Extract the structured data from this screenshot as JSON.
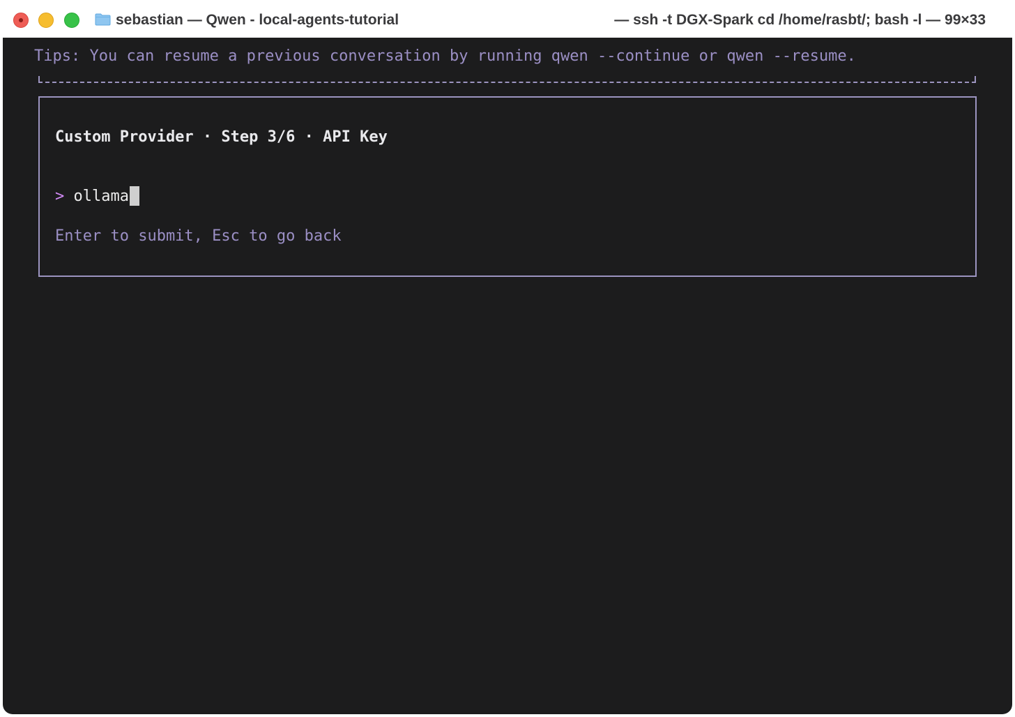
{
  "window": {
    "title_left": "sebastian — Qwen - local-agents-tutorial",
    "title_right": "— ssh -t DGX-Spark cd /home/rasbt/; bash -l — 99×33"
  },
  "terminal": {
    "tips": "Tips: You can resume a previous conversation by running qwen --continue or qwen --resume.",
    "dialog": {
      "title": "Custom Provider · Step 3/6 · API Key",
      "prompt_char": ">",
      "input_value": "ollama",
      "hint": "Enter to submit, Esc to go back"
    }
  },
  "colors": {
    "terminal_bg": "#1c1c1d",
    "accent_purple": "#9b8fc5",
    "prompt_magenta": "#d38bf7",
    "border": "#9c94c0"
  },
  "icons": {
    "close": "close-button",
    "minimize": "minimize-button",
    "maximize": "zoom-button",
    "folder": "folder-icon"
  }
}
